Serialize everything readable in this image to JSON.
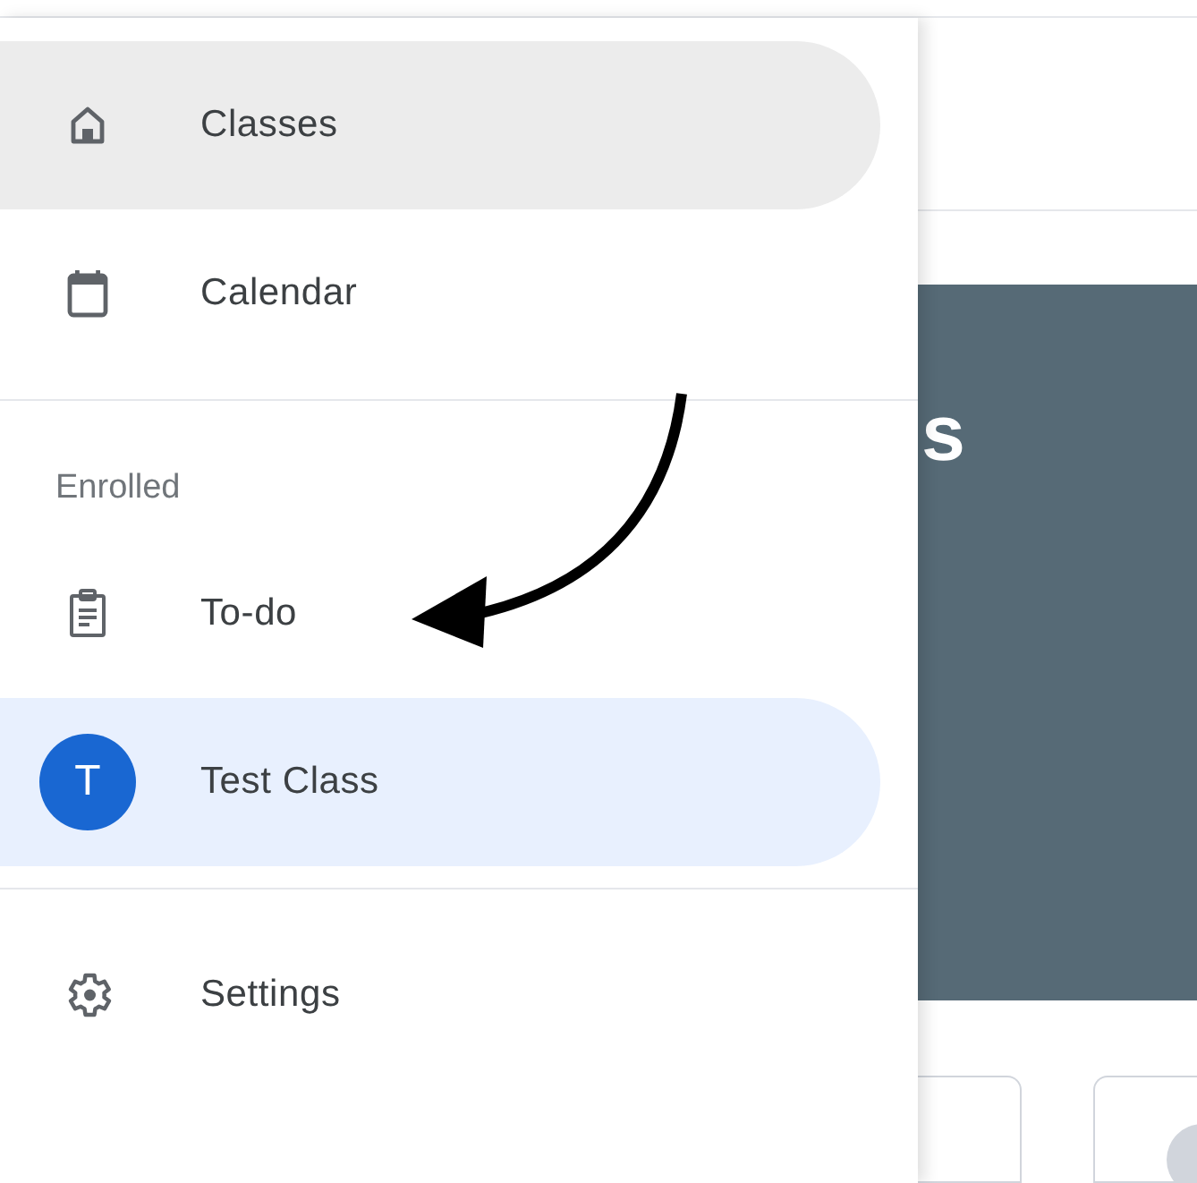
{
  "sidebar": {
    "sections": [
      {
        "items": [
          {
            "kind": "home",
            "label": "Classes",
            "hovered": true,
            "selected": false
          },
          {
            "kind": "calendar",
            "label": "Calendar",
            "hovered": false,
            "selected": false
          }
        ]
      },
      {
        "heading": "Enrolled",
        "items": [
          {
            "kind": "todo",
            "label": "To-do",
            "hovered": false,
            "selected": false
          },
          {
            "kind": "class",
            "label": "Test Class",
            "avatar_letter": "T",
            "color": "#1967d2",
            "hovered": false,
            "selected": true
          }
        ]
      },
      {
        "items": [
          {
            "kind": "settings",
            "label": "Settings",
            "hovered": false,
            "selected": false
          }
        ]
      }
    ]
  },
  "banner": {
    "title_fragment": "s"
  }
}
